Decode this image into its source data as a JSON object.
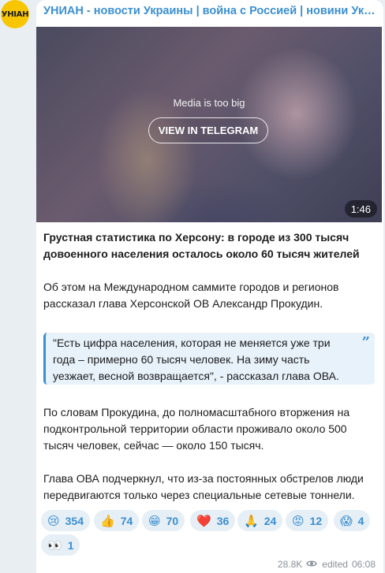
{
  "channel": {
    "avatar_text": "УНІАН",
    "title": "УНИАН - новости Украины | война с Россией | новини Україні..."
  },
  "media": {
    "notice": "Media is too big",
    "button_label": "VIEW IN TELEGRAM",
    "duration": "1:46"
  },
  "post": {
    "headline": "Грустная статистика по Херсону: в городе из 300 тысяч довоенного населения осталось около 60 тысяч жителей",
    "paragraph1": "Об этом на Международном саммите городов и регионов рассказал глава Херсонской ОВ Александр Прокудин.",
    "quote": "\"Есть цифра населения, которая не меняется уже три года – примерно 60 тысяч человек. На зиму часть уезжает, весной возвращается\", - рассказал глава ОВА.",
    "quote_icon": "quote-icon",
    "paragraph2": "По словам Прокудина, до полномасштабного вторжения на подконтрольной территории области проживало около 500 тысяч человек, сейчас — около 150 тысяч.",
    "paragraph3": "Глава ОВА подчеркнул, что из-за постоянных обстрелов люди передвигаются только через специальные сетевые тоннели."
  },
  "reactions": [
    {
      "emoji": "😢",
      "count": "354"
    },
    {
      "emoji": "👍",
      "count": "74"
    },
    {
      "emoji": "😁",
      "count": "70"
    },
    {
      "emoji": "❤️",
      "count": "36"
    },
    {
      "emoji": "🙏",
      "count": "24"
    },
    {
      "emoji": "😡",
      "count": "12"
    },
    {
      "emoji": "😱",
      "count": "4"
    },
    {
      "emoji": "👀",
      "count": "1"
    }
  ],
  "meta": {
    "views": "28.8K",
    "edited_label": "edited",
    "time": "06:08"
  },
  "colors": {
    "accent": "#3a8fd1",
    "avatar_bg": "#f7c600",
    "background": "#e8eef2"
  }
}
